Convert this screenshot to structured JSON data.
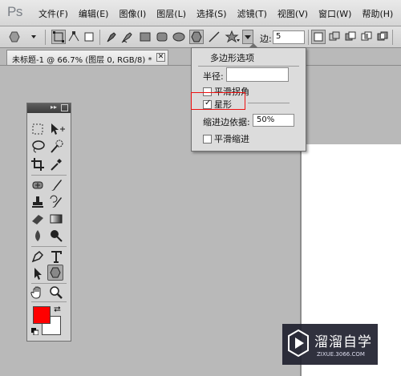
{
  "app": {
    "logo": "Ps"
  },
  "menubar": {
    "items": [
      "文件(F)",
      "编辑(E)",
      "图像(I)",
      "图层(L)",
      "选择(S)",
      "滤镜(T)",
      "视图(V)",
      "窗口(W)",
      "帮助(H)"
    ]
  },
  "options_bar": {
    "sides_label": "边:",
    "sides_value": "5",
    "icons": [
      "polygon-preset-icon",
      "shape-layers-icon",
      "paths-icon",
      "fill-pixels-icon",
      "pen-icon",
      "freeform-pen-icon",
      "rectangle-icon",
      "rounded-rectangle-icon",
      "ellipse-icon",
      "polygon-icon",
      "line-icon",
      "custom-shape-icon",
      "geometry-options-icon",
      "new-layer-icon",
      "add-icon",
      "subtract-icon",
      "intersect-icon",
      "exclude-icon"
    ]
  },
  "document_tab": {
    "title": "未标题-1 @ 66.7% (图层 0, RGB/8) *",
    "close": "✕"
  },
  "polygon_options": {
    "title": "多边形选项",
    "radius_label": "半径:",
    "radius_value": "",
    "smooth_corners_label": "平滑拐角",
    "smooth_corners_checked": false,
    "star_label": "星形",
    "star_checked": true,
    "indent_label": "缩进边依据:",
    "indent_value": "50%",
    "smooth_indents_label": "平滑缩进",
    "smooth_indents_checked": false
  },
  "toolbox": {
    "foreground_color": "#ff0000",
    "background_color": "#ffffff",
    "tools": [
      "marquee",
      "move",
      "lasso",
      "quick-selection",
      "crop",
      "eyedropper",
      "healing-brush",
      "brush",
      "clone-stamp",
      "history-brush",
      "eraser",
      "gradient",
      "blur",
      "dodge",
      "pen",
      "type",
      "path-selection",
      "polygon",
      "hand",
      "zoom"
    ],
    "active_tool": "polygon"
  },
  "watermark": {
    "name": "溜溜自学",
    "url": "ZIXUE.3066.COM"
  },
  "colors": {
    "highlight": "#ee1111",
    "workspace": "#b9b9b9"
  }
}
